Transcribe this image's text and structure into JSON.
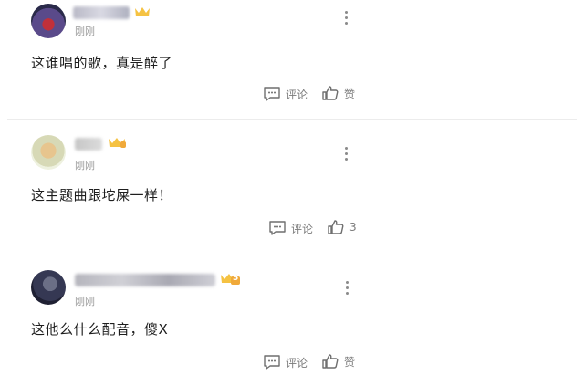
{
  "comments": [
    {
      "time": "刚刚",
      "text": "这谁唱的歌，真是醉了",
      "comment_label": "评论",
      "like_label": "赞"
    },
    {
      "time": "刚刚",
      "text": "这主题曲跟坨屎一样！",
      "comment_label": "评论",
      "like_count": "3"
    },
    {
      "time": "刚刚",
      "text": "这他么什么配音，傻X",
      "comment_label": "评论",
      "like_label": "赞",
      "badge_level": "5"
    }
  ],
  "icons": [
    "more-vertical-icon",
    "comment-icon",
    "thumbs-up-icon",
    "vip-crown-badge-icon"
  ],
  "colors": {
    "badge_gold": "#f5c242",
    "text_primary": "#1e1e1e",
    "text_secondary": "#9a9a9a",
    "action_gray": "#7a7a7a"
  }
}
